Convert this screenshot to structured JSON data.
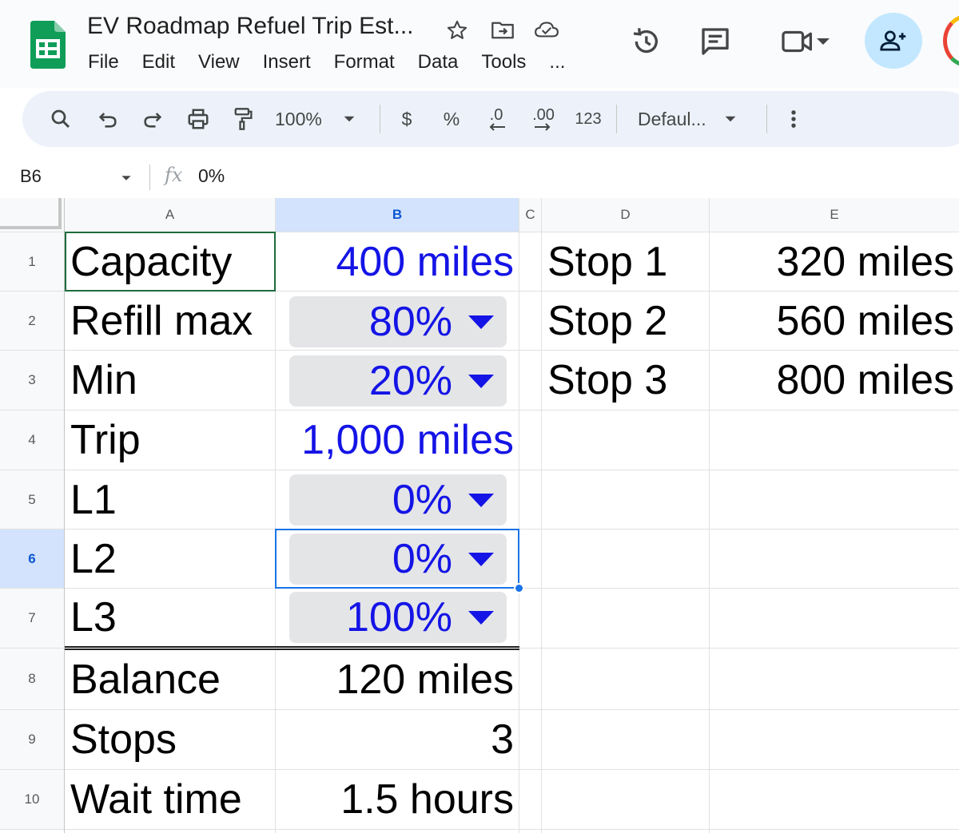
{
  "app": {
    "doc_title": "EV Roadmap Refuel Trip Est...",
    "menu": [
      "File",
      "Edit",
      "View",
      "Insert",
      "Format",
      "Data",
      "Tools",
      "..."
    ]
  },
  "toolbar": {
    "zoom": "100%",
    "currency": "$",
    "percent": "%",
    "decrease_decimal": ".0",
    "increase_decimal": ".00",
    "number_format": "123",
    "font": "Defaul..."
  },
  "formula_bar": {
    "cell_ref": "B6",
    "fx": "fx",
    "value": "0%"
  },
  "columns": [
    "A",
    "B",
    "C",
    "D",
    "E"
  ],
  "rows": [
    "1",
    "2",
    "3",
    "4",
    "5",
    "6",
    "7",
    "8",
    "9",
    "10"
  ],
  "cells": {
    "A1": "Capacity",
    "B1": "400 miles",
    "A2": "Refill max",
    "B2": "80%",
    "A3": "Min",
    "B3": "20%",
    "A4": "Trip",
    "B4": "1,000 miles",
    "A5": "L1",
    "B5": "0%",
    "A6": "L2",
    "B6": "0%",
    "A7": "L3",
    "B7": "100%",
    "A8": "Balance",
    "B8": "120 miles",
    "A9": "Stops",
    "B9": "3",
    "A10": "Wait time",
    "B10": "1.5 hours",
    "D1": "Stop 1",
    "E1": "320 miles",
    "D2": "Stop 2",
    "E2": "560 miles",
    "D3": "Stop 3",
    "E3": "800 miles"
  },
  "selection": {
    "active_cell": "B6",
    "selected_row": "6",
    "selected_column": "B"
  },
  "colors": {
    "input_text": "#1414e6",
    "selection_border": "#1a73e8",
    "header_selected": "#d3e3fd",
    "chip_bg": "#e4e5e7",
    "sheets_green": "#0f9d58",
    "share_button": "#c2e7ff"
  },
  "icons": {
    "star": "star-icon",
    "move": "move-to-folder-icon",
    "cloud": "cloud-status-icon",
    "history": "history-icon",
    "comments": "comments-icon",
    "meet": "video-call-icon",
    "share": "add-person-icon",
    "search": "search-icon",
    "undo": "undo-icon",
    "redo": "redo-icon",
    "print": "print-icon",
    "paint_format": "paint-format-icon",
    "more": "more-vert-icon"
  }
}
